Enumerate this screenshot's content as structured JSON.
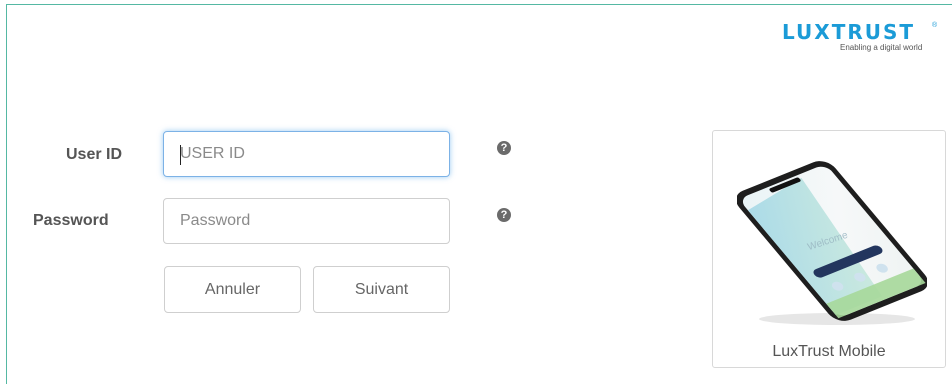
{
  "brand": {
    "logo_text": "LUXTRUST",
    "registered_mark": "®",
    "tagline": "Enabling a digital world",
    "color": "#1b9bd7"
  },
  "form": {
    "user_id": {
      "label": "User ID",
      "placeholder": "USER ID",
      "value": ""
    },
    "password": {
      "label": "Password",
      "placeholder": "Password",
      "value": ""
    },
    "help_icon_glyph": "?",
    "buttons": {
      "cancel": "Annuler",
      "next": "Suivant"
    }
  },
  "mobile_card": {
    "caption": "LuxTrust Mobile",
    "phone_screen_text": "Welcome"
  },
  "colors": {
    "frame_border": "#55b8a3",
    "focus_border": "#7cb2e6"
  }
}
